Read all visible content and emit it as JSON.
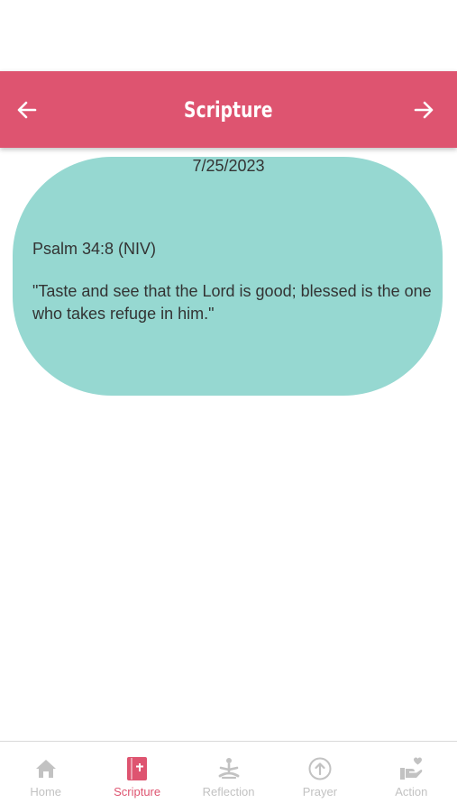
{
  "header": {
    "title": "Scripture",
    "back_icon": "arrow-left-icon",
    "forward_icon": "arrow-right-icon",
    "color": "#de5470"
  },
  "card": {
    "date": "7/25/2023",
    "reference": "Psalm 34:8 (NIV)",
    "verse": "\"Taste and see that the Lord is good; blessed is the one who takes refuge in him.\"",
    "color": "#96d8d1"
  },
  "bottom_nav": {
    "active": "Scripture",
    "active_color": "#de5470",
    "inactive_color": "#c2c2c2",
    "tabs": [
      {
        "label": "Home",
        "icon": "home-icon"
      },
      {
        "label": "Scripture",
        "icon": "bible-book-icon"
      },
      {
        "label": "Reflection",
        "icon": "meditation-icon"
      },
      {
        "label": "Prayer",
        "icon": "upload-circle-icon"
      },
      {
        "label": "Action",
        "icon": "giving-hand-heart-icon"
      }
    ]
  }
}
